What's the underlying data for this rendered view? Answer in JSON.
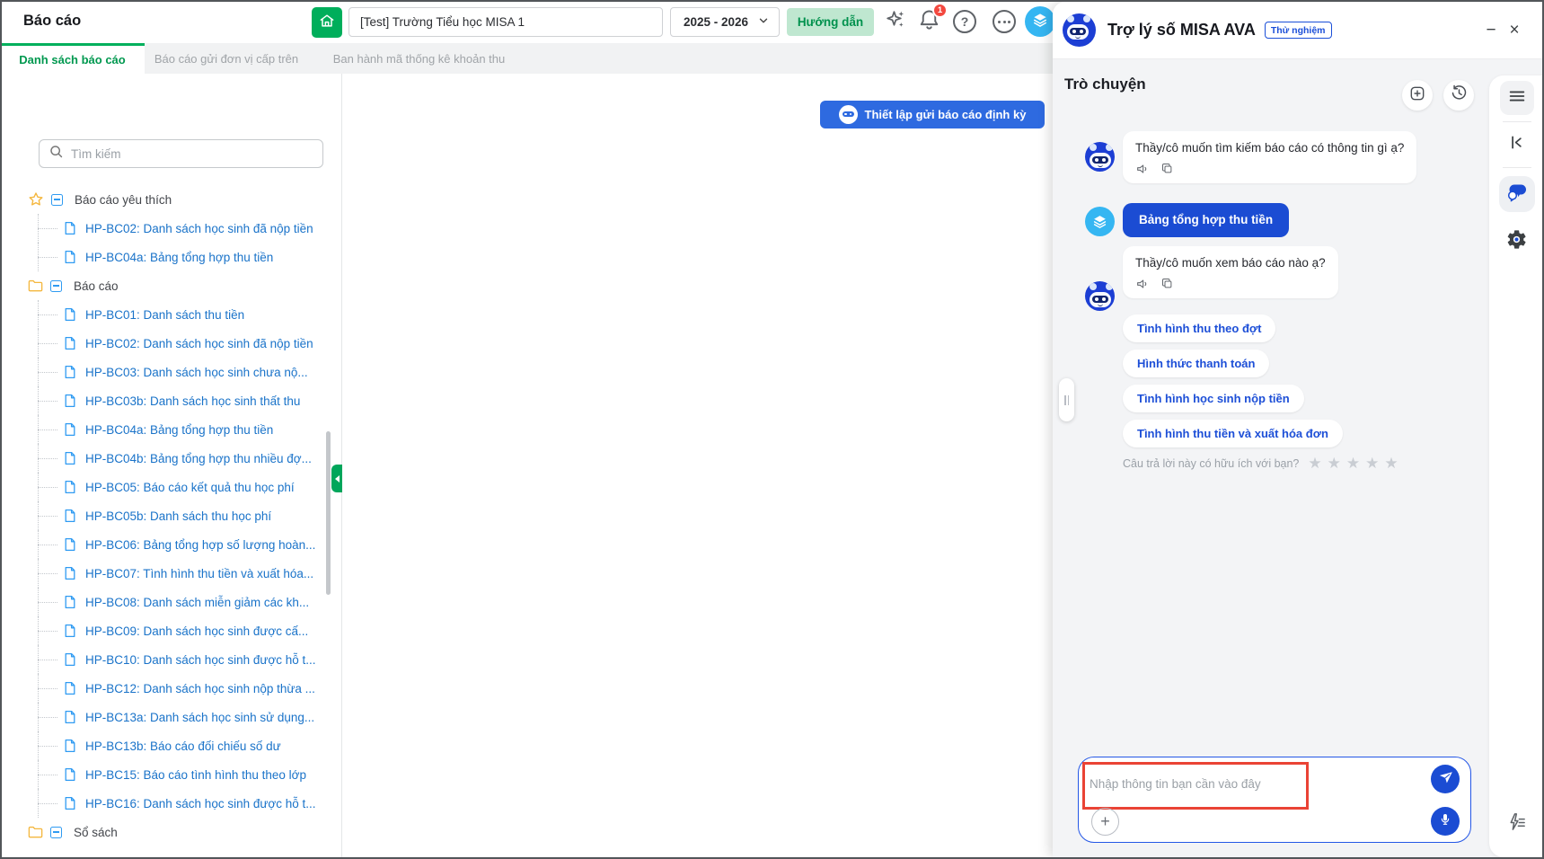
{
  "topbar": {
    "page_title": "Báo cáo",
    "school_name": "[Test] Trường Tiểu học MISA 1",
    "school_year": "2025 - 2026",
    "guide_label": "Hướng dẫn",
    "notification_count": "1"
  },
  "tabs": [
    {
      "label": "Danh sách báo cáo",
      "active": true
    },
    {
      "label": "Báo cáo gửi đơn vị cấp trên",
      "active": false
    },
    {
      "label": "Ban hành mã thống kê khoản thu",
      "active": false
    }
  ],
  "content": {
    "setup_button_label": "Thiết lập gửi báo cáo định kỳ",
    "search_placeholder": "Tìm kiếm",
    "tree": [
      {
        "type": "group",
        "icon": "star",
        "label": "Báo cáo yêu thích"
      },
      {
        "type": "item",
        "label": "HP-BC02: Danh sách học sinh đã nộp tiền"
      },
      {
        "type": "item",
        "label": "HP-BC04a: Bảng tổng hợp thu tiền"
      },
      {
        "type": "group",
        "icon": "folder",
        "label": "Báo cáo"
      },
      {
        "type": "item",
        "label": "HP-BC01: Danh sách thu tiền"
      },
      {
        "type": "item",
        "label": "HP-BC02: Danh sách học sinh đã nộp tiền"
      },
      {
        "type": "item",
        "label": "HP-BC03: Danh sách học sinh chưa nộ..."
      },
      {
        "type": "item",
        "label": "HP-BC03b: Danh sách học sinh thất thu"
      },
      {
        "type": "item",
        "label": "HP-BC04a: Bảng tổng hợp thu tiền"
      },
      {
        "type": "item",
        "label": "HP-BC04b: Bảng tổng hợp thu nhiều đợ..."
      },
      {
        "type": "item",
        "label": "HP-BC05: Báo cáo kết quả thu học phí"
      },
      {
        "type": "item",
        "label": "HP-BC05b: Danh sách thu học phí"
      },
      {
        "type": "item",
        "label": "HP-BC06: Bảng tổng hợp số lượng hoàn..."
      },
      {
        "type": "item",
        "label": "HP-BC07: Tình hình thu tiền và xuất hóa..."
      },
      {
        "type": "item",
        "label": "HP-BC08: Danh sách miễn giảm các kh..."
      },
      {
        "type": "item",
        "label": "HP-BC09: Danh sách học sinh được cấ..."
      },
      {
        "type": "item",
        "label": "HP-BC10: Danh sách học sinh được hỗ t..."
      },
      {
        "type": "item",
        "label": "HP-BC12: Danh sách học sinh nộp thừa ..."
      },
      {
        "type": "item",
        "label": "HP-BC13a: Danh sách học sinh sử dụng..."
      },
      {
        "type": "item",
        "label": "HP-BC13b: Báo cáo đối chiếu số dư"
      },
      {
        "type": "item",
        "label": "HP-BC15: Báo cáo tình hình thu theo lớp"
      },
      {
        "type": "item",
        "label": "HP-BC16: Danh sách học sinh được hỗ t..."
      },
      {
        "type": "group",
        "icon": "folder",
        "label": "Sổ sách"
      }
    ]
  },
  "chat": {
    "assistant_title": "Trợ lý số MISA AVA",
    "badge": "Thử nghiệm",
    "section_title": "Trò chuyện",
    "messages": [
      {
        "role": "bot",
        "text": "Thầy/cô muốn tìm kiếm báo cáo có thông tin gì ạ?"
      },
      {
        "role": "user",
        "text": "Bảng tổng hợp thu tiền"
      },
      {
        "role": "bot",
        "text": "Thầy/cô muốn xem báo cáo nào ạ?"
      }
    ],
    "quick_replies": [
      "Tình hình thu theo đợt",
      "Hình thức thanh toán",
      "Tình hình học sinh nộp tiền",
      "Tình hình thu tiền và xuất hóa đơn"
    ],
    "rating_prompt": "Câu trả lời này có hữu ích với bạn?",
    "rating_star_count": 5,
    "input_placeholder": "Nhập thông tin bạn cần vào đây"
  },
  "icons": {
    "minimize_glyph": "−",
    "close_glyph": "×",
    "help_glyph": "?",
    "attach_glyph": "+",
    "star_glyph": "★"
  },
  "colors": {
    "brand_green": "#00b05c",
    "setup_button_blue": "#2e6ae0",
    "ava_blue": "#1b4cd3",
    "user_avatar_blue": "#35b6f2",
    "tree_item_blue": "#1a73c9",
    "annotation_red": "#ea4335",
    "notification_red": "#f3483f"
  }
}
